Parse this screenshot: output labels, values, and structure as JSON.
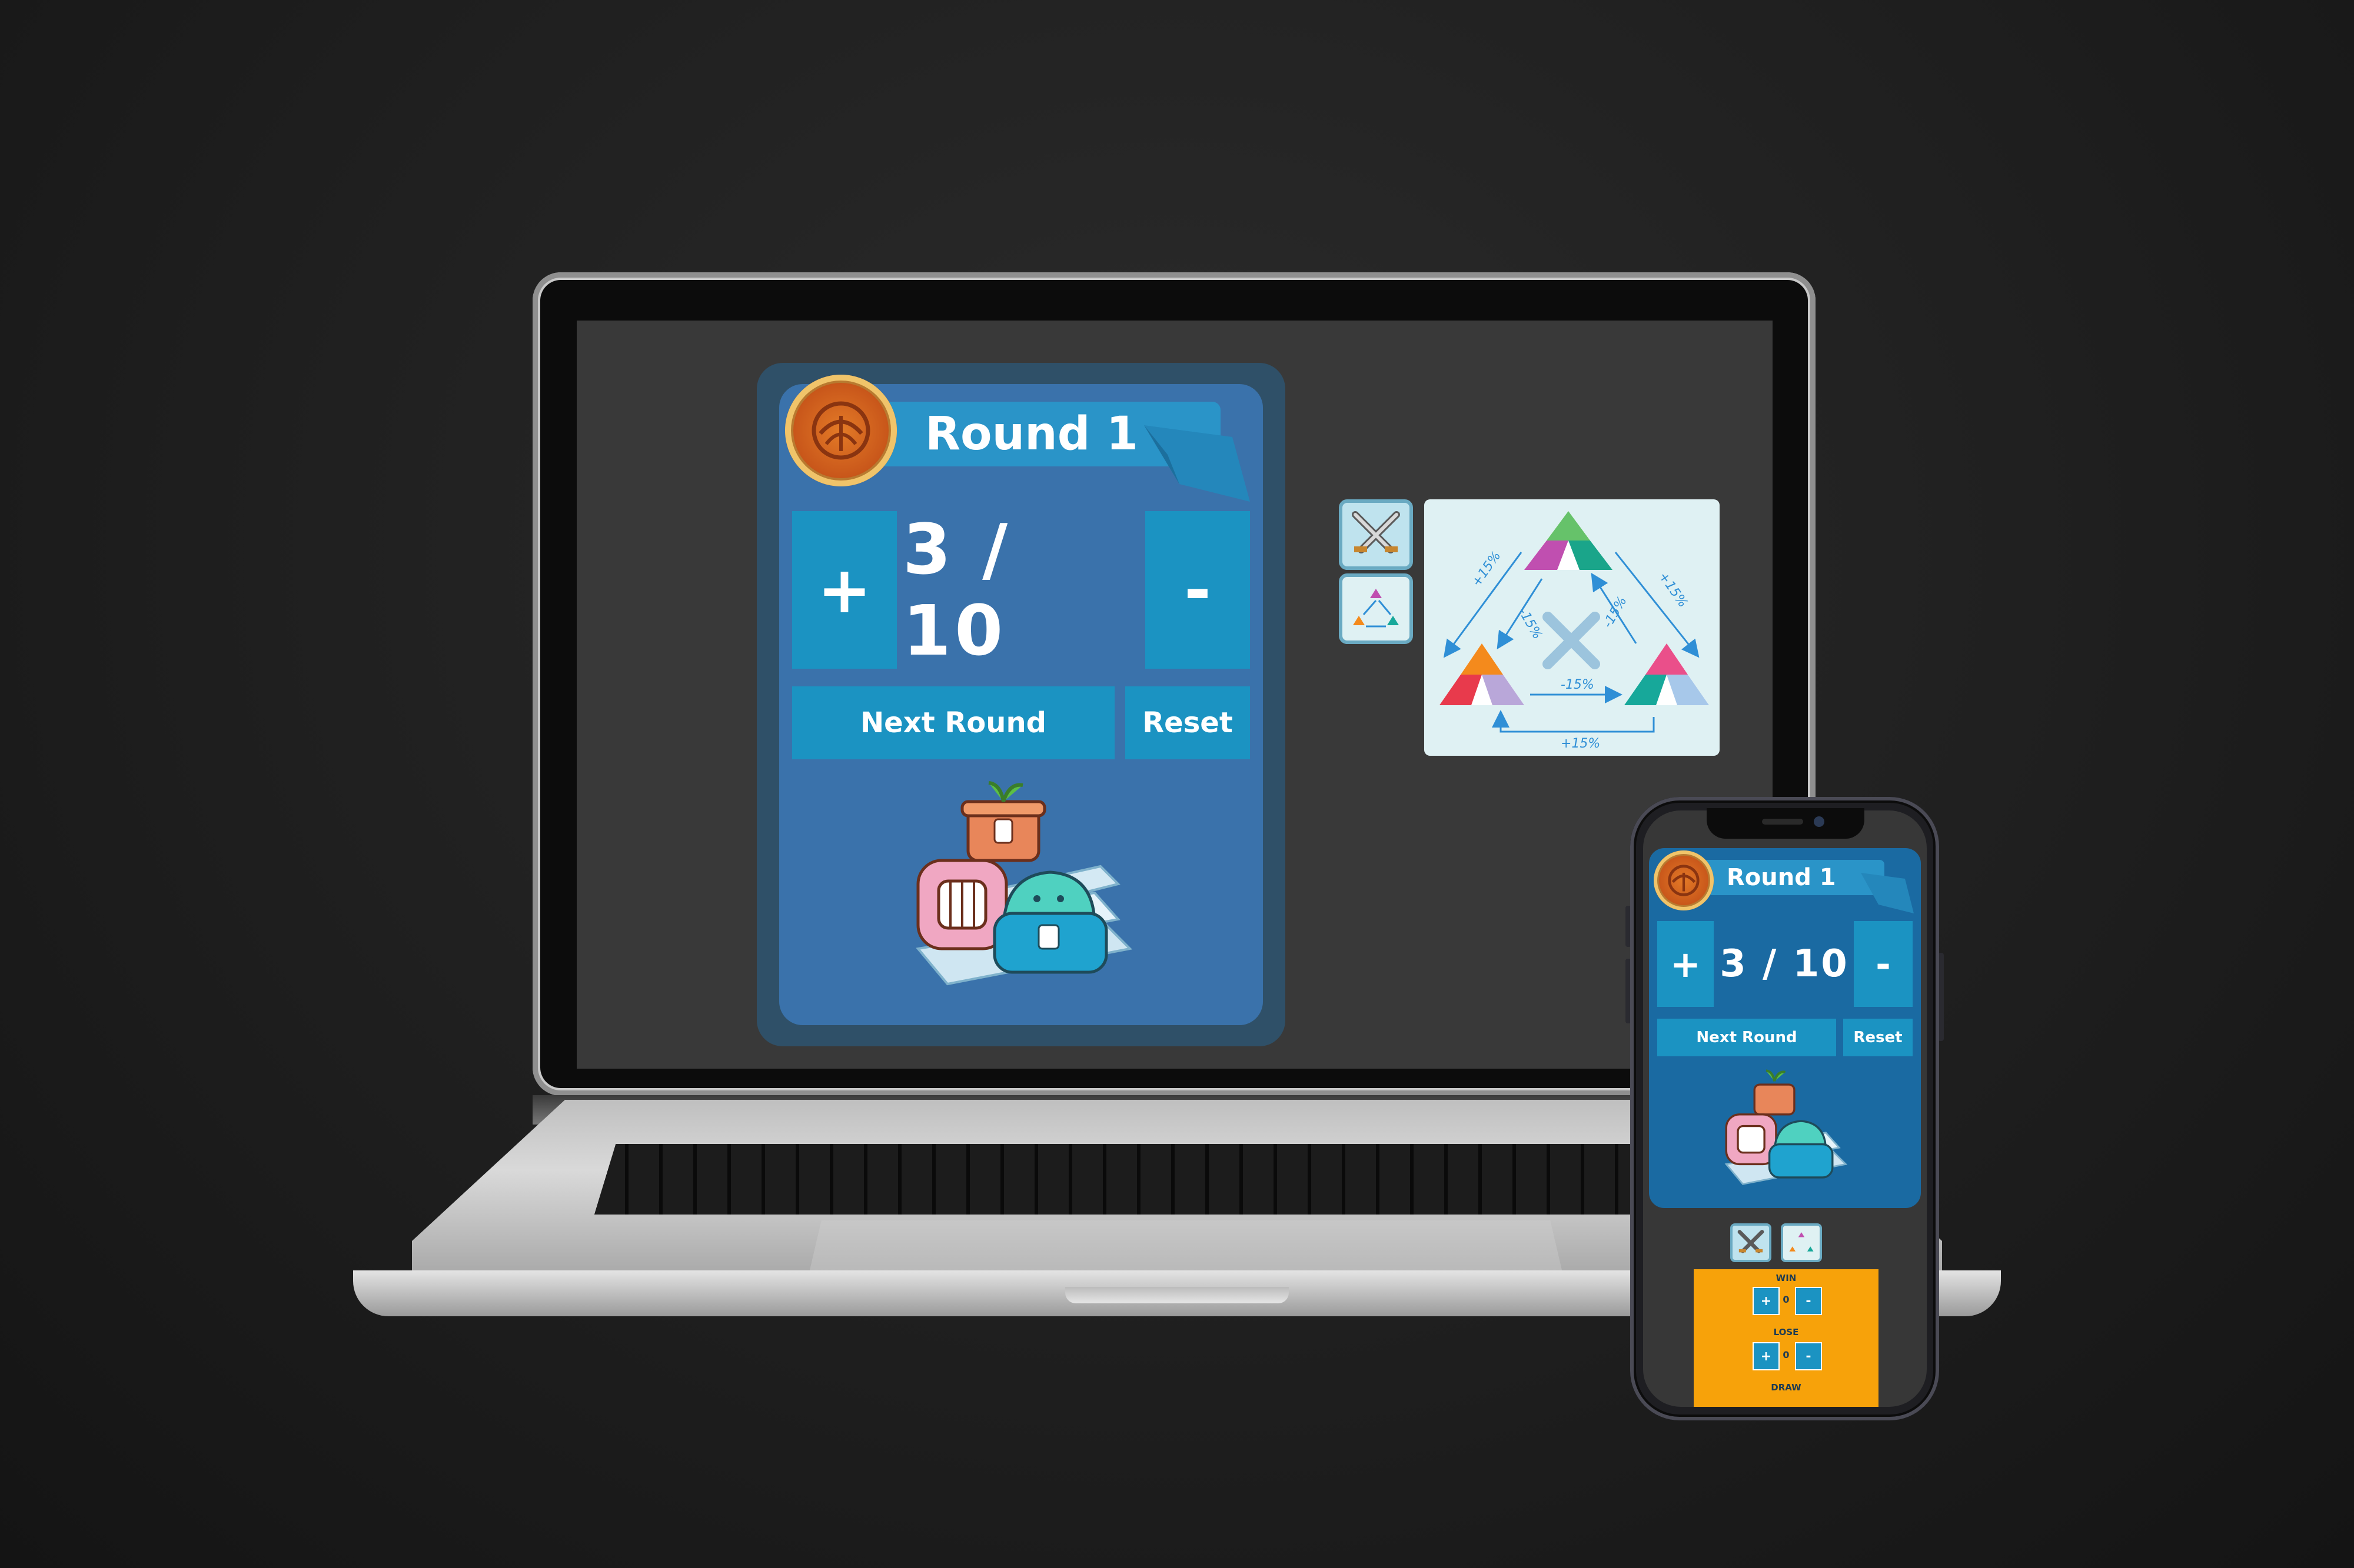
{
  "desktop": {
    "round_label": "Round 1",
    "counter": "3 / 10",
    "plus_label": "+",
    "minus_label": "-",
    "next_round_label": "Next Round",
    "reset_label": "Reset",
    "side_icons": [
      "crossed-swords-icon",
      "class-advantage-icon"
    ],
    "advantage_chart": {
      "labels": [
        "+15%",
        "+15%",
        "+15%",
        "-15%",
        "-15%",
        "-15%"
      ]
    }
  },
  "mobile": {
    "round_label": "Round 1",
    "counter": "3 / 10",
    "plus_label": "+",
    "minus_label": "-",
    "next_round_label": "Next Round",
    "reset_label": "Reset",
    "results_panel": {
      "win_label": "WIN",
      "lose_label": "LOSE",
      "draw_label": "DRAW",
      "stepper_plus": "+",
      "stepper_minus": "-",
      "stepper_value": "0"
    }
  },
  "colors": {
    "card_outer": "#2f5068",
    "card_inner": "#3a72ab",
    "tile": "#1b93c2",
    "ribbon": "#2a94c8",
    "results_panel": "#f7a20a",
    "chart_bg": "#dff1f3"
  }
}
